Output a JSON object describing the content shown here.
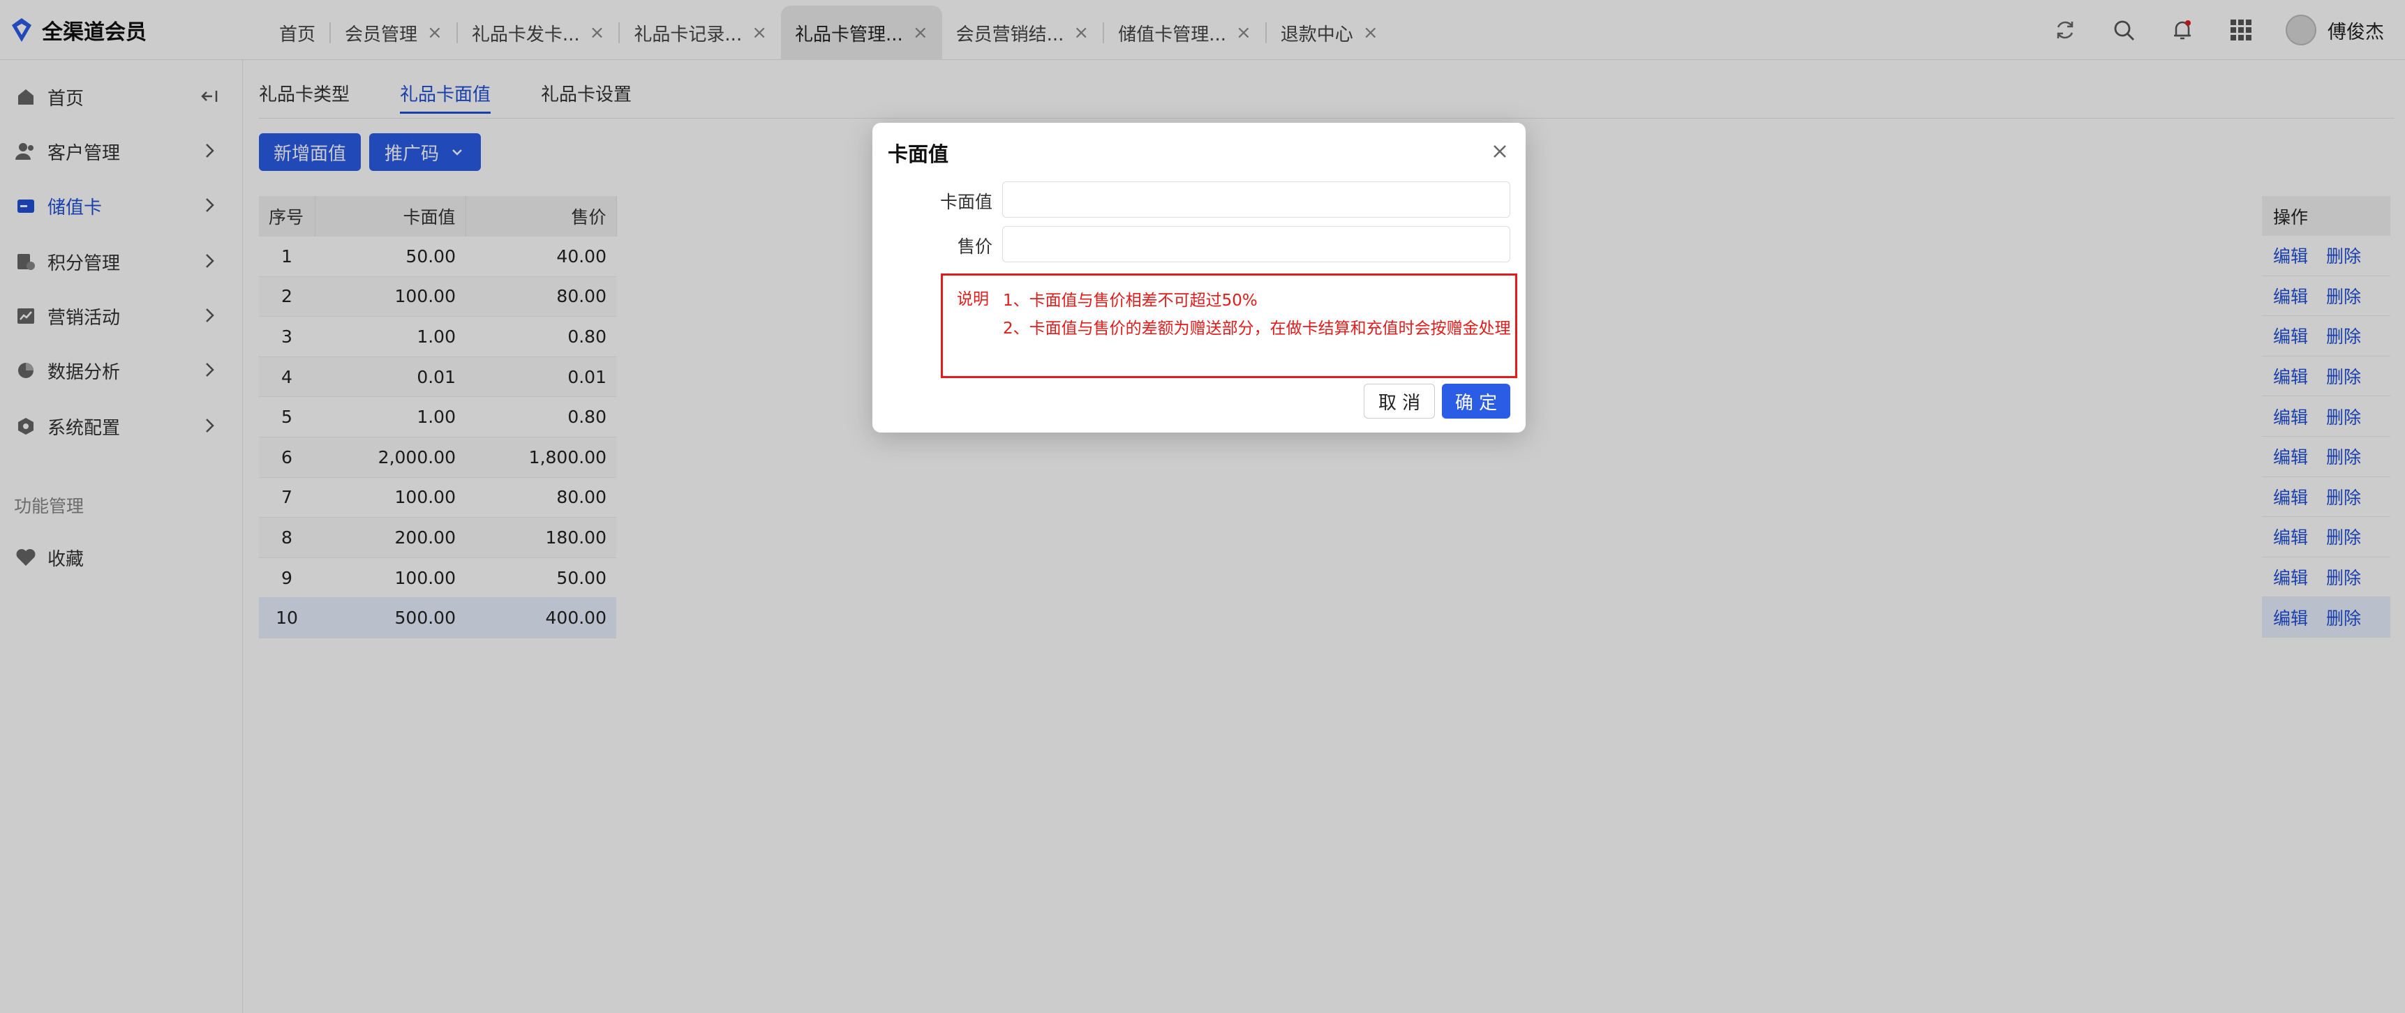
{
  "app": {
    "name": "全渠道会员"
  },
  "tabs": [
    {
      "label": "首页",
      "closable": false,
      "active": false
    },
    {
      "label": "会员管理",
      "closable": true,
      "active": false
    },
    {
      "label": "礼品卡发卡...",
      "closable": true,
      "active": false
    },
    {
      "label": "礼品卡记录...",
      "closable": true,
      "active": false
    },
    {
      "label": "礼品卡管理...",
      "closable": true,
      "active": true
    },
    {
      "label": "会员营销结...",
      "closable": true,
      "active": false
    },
    {
      "label": "储值卡管理...",
      "closable": true,
      "active": false
    },
    {
      "label": "退款中心",
      "closable": true,
      "active": false
    }
  ],
  "topbar": {
    "close_glyph": "×",
    "user_name": "傅俊杰",
    "icons": [
      "refresh-icon",
      "search-icon",
      "bell-icon",
      "apps-grid-icon"
    ]
  },
  "sidebar": {
    "items": [
      {
        "label": "首页",
        "icon": "home-icon",
        "active": false
      },
      {
        "label": "客户管理",
        "icon": "users-icon",
        "active": false
      },
      {
        "label": "储值卡",
        "icon": "card-icon",
        "active": true
      },
      {
        "label": "积分管理",
        "icon": "points-icon",
        "active": false
      },
      {
        "label": "营销活动",
        "icon": "chart-line-icon",
        "active": false
      },
      {
        "label": "数据分析",
        "icon": "pie-icon",
        "active": false
      },
      {
        "label": "系统配置",
        "icon": "settings-hex-icon",
        "active": false
      }
    ],
    "section_label": "功能管理",
    "favorites": {
      "label": "收藏",
      "icon": "heart-icon"
    }
  },
  "subtabs": [
    {
      "label": "礼品卡类型",
      "active": false
    },
    {
      "label": "礼品卡面值",
      "active": true
    },
    {
      "label": "礼品卡设置",
      "active": false
    }
  ],
  "toolbar": {
    "add_label": "新增面值",
    "promo_label": "推广码"
  },
  "table": {
    "columns": [
      "序号",
      "卡面值",
      "售价"
    ],
    "ops_header": "操作",
    "edit_label": "编辑",
    "delete_label": "删除",
    "rows": [
      {
        "index": "1",
        "face": "50.00",
        "price": "40.00"
      },
      {
        "index": "2",
        "face": "100.00",
        "price": "80.00"
      },
      {
        "index": "3",
        "face": "1.00",
        "price": "0.80"
      },
      {
        "index": "4",
        "face": "0.01",
        "price": "0.01"
      },
      {
        "index": "5",
        "face": "1.00",
        "price": "0.80"
      },
      {
        "index": "6",
        "face": "2,000.00",
        "price": "1,800.00"
      },
      {
        "index": "7",
        "face": "100.00",
        "price": "80.00"
      },
      {
        "index": "8",
        "face": "200.00",
        "price": "180.00"
      },
      {
        "index": "9",
        "face": "100.00",
        "price": "50.00"
      },
      {
        "index": "10",
        "face": "500.00",
        "price": "400.00"
      }
    ],
    "selected_index": 9
  },
  "modal": {
    "title": "卡面值",
    "face_label": "卡面值",
    "face_value": "",
    "price_label": "售价",
    "price_value": "",
    "note_label": "说明",
    "note_line1": "1、卡面值与售价相差不可超过50%",
    "note_line2": "2、卡面值与售价的差额为赠送部分，在做卡结算和充值时会按赠金处理",
    "cancel_label": "取 消",
    "ok_label": "确 定"
  },
  "colors": {
    "accent": "#2a5ce6",
    "link": "#1f4fd6",
    "warning": "#e21b1b",
    "overlay": "rgba(0,0,0,0.2)"
  }
}
